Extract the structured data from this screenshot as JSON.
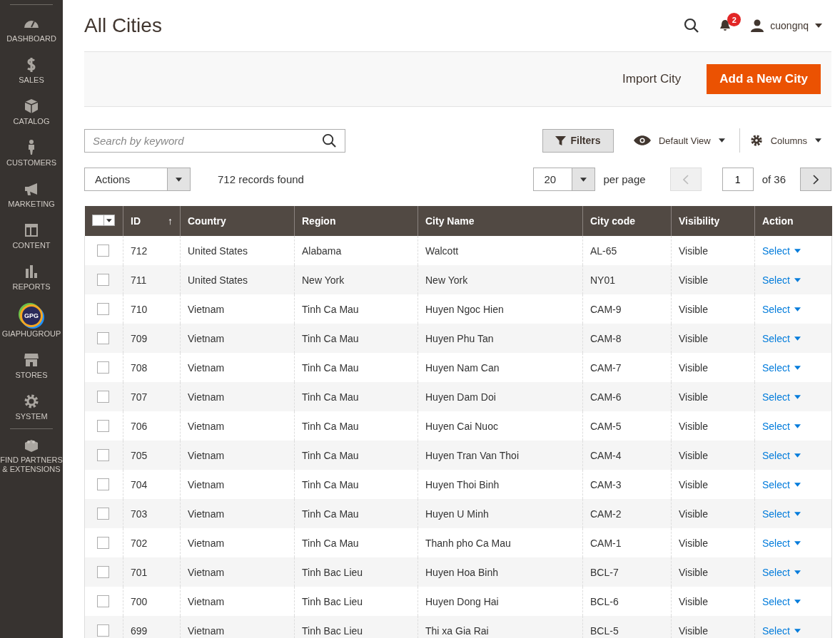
{
  "sidebar": {
    "items": [
      {
        "label": "DASHBOARD"
      },
      {
        "label": "SALES"
      },
      {
        "label": "CATALOG"
      },
      {
        "label": "CUSTOMERS"
      },
      {
        "label": "MARKETING"
      },
      {
        "label": "CONTENT"
      },
      {
        "label": "REPORTS"
      },
      {
        "label": "GIAPHUGROUP",
        "logo": "GPG"
      },
      {
        "label": "STORES"
      },
      {
        "label": "SYSTEM"
      },
      {
        "label": "FIND PARTNERS & EXTENSIONS"
      }
    ]
  },
  "header": {
    "title": "All Cities",
    "notifications": "2",
    "user": "cuongnq"
  },
  "actions_bar": {
    "secondary": "Import City",
    "primary": "Add a New City"
  },
  "toolbar": {
    "search": {
      "placeholder": "Search by keyword"
    },
    "filters": "Filters",
    "view": "Default View",
    "columns": "Columns",
    "mass_action": "Actions",
    "records": "712 records found",
    "page_size": "20",
    "per_page": "per page",
    "page": "1",
    "of_pages": "of 36"
  },
  "table": {
    "select_all": {
      "checked": false
    },
    "columns": [
      "ID",
      "Country",
      "Region",
      "City Name",
      "City code",
      "Visibility",
      "Action"
    ],
    "sort_arrow": "↑",
    "rows": [
      {
        "checked": false,
        "cells": [
          "712",
          "United States",
          "Alabama",
          "Walcott",
          "AL-65",
          "Visible"
        ],
        "action": "Select"
      },
      {
        "checked": false,
        "cells": [
          "711",
          "United States",
          "New York",
          "New York",
          "NY01",
          "Visible"
        ],
        "action": "Select"
      },
      {
        "checked": false,
        "cells": [
          "710",
          "Vietnam",
          "Tinh Ca Mau",
          "Huyen Ngoc Hien",
          "CAM-9",
          "Visible"
        ],
        "action": "Select"
      },
      {
        "checked": false,
        "cells": [
          "709",
          "Vietnam",
          "Tinh Ca Mau",
          "Huyen Phu Tan",
          "CAM-8",
          "Visible"
        ],
        "action": "Select"
      },
      {
        "checked": false,
        "cells": [
          "708",
          "Vietnam",
          "Tinh Ca Mau",
          "Huyen Nam Can",
          "CAM-7",
          "Visible"
        ],
        "action": "Select"
      },
      {
        "checked": false,
        "cells": [
          "707",
          "Vietnam",
          "Tinh Ca Mau",
          "Huyen Dam Doi",
          "CAM-6",
          "Visible"
        ],
        "action": "Select"
      },
      {
        "checked": false,
        "cells": [
          "706",
          "Vietnam",
          "Tinh Ca Mau",
          "Huyen Cai Nuoc",
          "CAM-5",
          "Visible"
        ],
        "action": "Select"
      },
      {
        "checked": false,
        "cells": [
          "705",
          "Vietnam",
          "Tinh Ca Mau",
          "Huyen Tran Van Thoi",
          "CAM-4",
          "Visible"
        ],
        "action": "Select"
      },
      {
        "checked": false,
        "cells": [
          "704",
          "Vietnam",
          "Tinh Ca Mau",
          "Huyen Thoi Binh",
          "CAM-3",
          "Visible"
        ],
        "action": "Select"
      },
      {
        "checked": false,
        "cells": [
          "703",
          "Vietnam",
          "Tinh Ca Mau",
          "Huyen U Minh",
          "CAM-2",
          "Visible"
        ],
        "action": "Select"
      },
      {
        "checked": false,
        "cells": [
          "702",
          "Vietnam",
          "Tinh Ca Mau",
          "Thanh pho Ca Mau",
          "CAM-1",
          "Visible"
        ],
        "action": "Select"
      },
      {
        "checked": false,
        "cells": [
          "701",
          "Vietnam",
          "Tinh Bac Lieu",
          "Huyen Hoa Binh",
          "BCL-7",
          "Visible"
        ],
        "action": "Select"
      },
      {
        "checked": false,
        "cells": [
          "700",
          "Vietnam",
          "Tinh Bac Lieu",
          "Huyen Dong Hai",
          "BCL-6",
          "Visible"
        ],
        "action": "Select"
      },
      {
        "checked": false,
        "cells": [
          "699",
          "Vietnam",
          "Tinh Bac Lieu",
          "Thi xa Gia Rai",
          "BCL-5",
          "Visible"
        ],
        "action": "Select"
      }
    ]
  }
}
